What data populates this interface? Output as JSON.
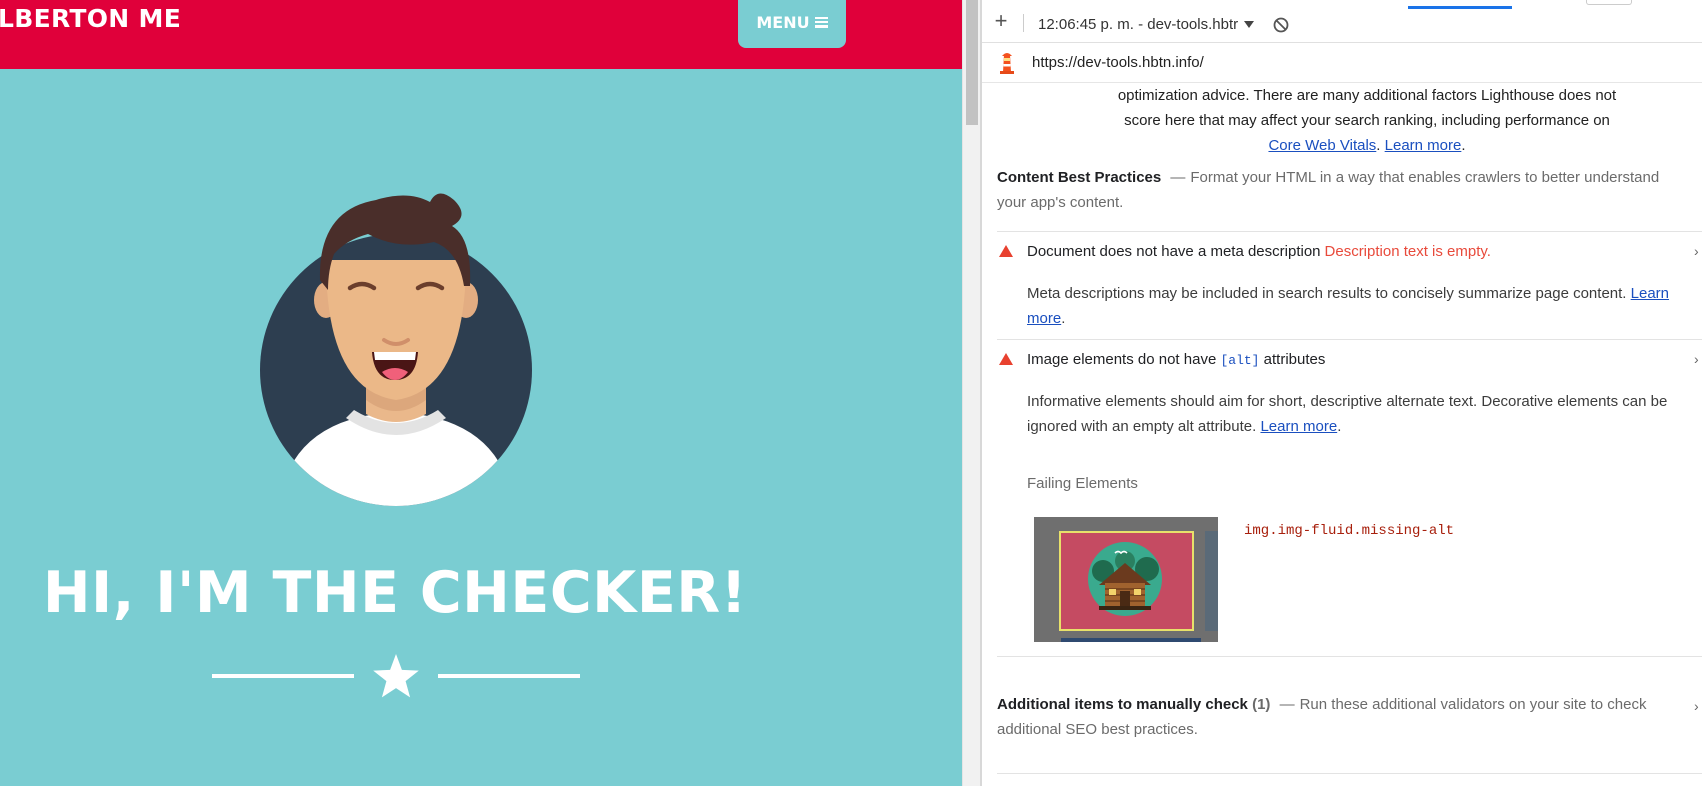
{
  "site": {
    "brand": "LBERTON ME",
    "menu_label": "MENU",
    "hero_title": "HI, I'M THE CHECKER!",
    "colors": {
      "navbar": "#e0003a",
      "background": "#7acdd2",
      "text": "#ffffff"
    }
  },
  "devtools": {
    "report_select": "12:06:45 p. m. - dev-tools.hbtr",
    "url": "https://dev-tools.hbtn.info/",
    "intro": {
      "line1": "optimization advice. There are many additional factors Lighthouse does not",
      "line2": "score here that may affect your search ranking, including performance on",
      "link_cwv": "Core Web Vitals",
      "link_learn": "Learn more",
      "period": "."
    },
    "content_best_practices": {
      "title": "Content Best Practices",
      "dash": "—",
      "description": "Format your HTML in a way that enables crawlers to better understand your app's content."
    },
    "audits": [
      {
        "title": "Document does not have a meta description",
        "error": "Description text is empty.",
        "description": "Meta descriptions may be included in search results to concisely summarize page content.",
        "link": "Learn more",
        "period": "."
      },
      {
        "title_pre": "Image elements do not have",
        "title_code": "[alt]",
        "title_post": "attributes",
        "description": "Informative elements should aim for short, descriptive alternate text. Decorative elements can be ignored with an empty alt attribute.",
        "link": "Learn more",
        "period": ".",
        "failing_label": "Failing Elements",
        "failing_selector": "img.img-fluid.missing-alt"
      }
    ],
    "additional": {
      "title": "Additional items to manually check",
      "count": "(1)",
      "dash": "—",
      "description": "Run these additional validators on your site to check additional SEO best practices."
    },
    "colors": {
      "accent": "#1a73e8",
      "warning": "#e8412f",
      "link": "#1a4fbf"
    }
  }
}
